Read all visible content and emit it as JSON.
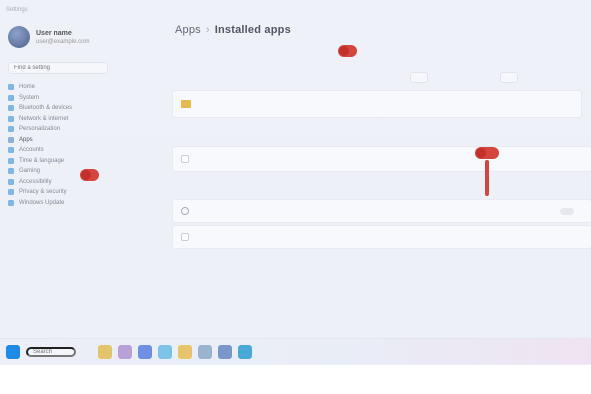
{
  "window": {
    "title": "Settings"
  },
  "user": {
    "name": "User name",
    "email": "user@example.com"
  },
  "sidebar": {
    "search_placeholder": "Find a setting",
    "items": [
      {
        "label": "Home",
        "color": "#7fb6e6"
      },
      {
        "label": "System",
        "color": "#7fb6e6"
      },
      {
        "label": "Bluetooth & devices",
        "color": "#7fb6e6"
      },
      {
        "label": "Network & internet",
        "color": "#7fb6e6"
      },
      {
        "label": "Personalization",
        "color": "#7fb6e6"
      },
      {
        "label": "Apps",
        "color": "#8db1d6"
      },
      {
        "label": "Accounts",
        "color": "#7fb6e6"
      },
      {
        "label": "Time & language",
        "color": "#7fb6e6"
      },
      {
        "label": "Gaming",
        "color": "#7fb6e6"
      },
      {
        "label": "Accessibility",
        "color": "#7fb6e6"
      },
      {
        "label": "Privacy & security",
        "color": "#7fb6e6"
      },
      {
        "label": "Windows Update",
        "color": "#7fb6e6"
      }
    ]
  },
  "main": {
    "breadcrumb": {
      "parent": "Apps",
      "current": "Installed apps"
    },
    "subtitle": "",
    "top_right": "",
    "section1": {
      "label": "",
      "buttons": [
        "",
        ""
      ],
      "row": {
        "title": "",
        "sub": ""
      }
    },
    "section2": {
      "label": "",
      "row": {
        "title": "",
        "sub": ""
      }
    },
    "section3": {
      "label": "",
      "row1": {
        "title": ""
      },
      "row2": {
        "title": ""
      }
    },
    "links": [
      "",
      ""
    ]
  },
  "annotations": [
    {
      "label": ""
    },
    {
      "label": ""
    },
    {
      "label": ""
    }
  ],
  "taskbar": {
    "search_placeholder": "Search",
    "apps": [
      "#e3c46b",
      "#b9a1d8",
      "#6f8fe0",
      "#7cc3e8",
      "#e8c36a",
      "#9ab3cf",
      "#7b96c9",
      "#4aa8d8"
    ],
    "tray": ""
  },
  "colors": {
    "accent": "#1f8ae6",
    "annotation": "#d6453d"
  }
}
